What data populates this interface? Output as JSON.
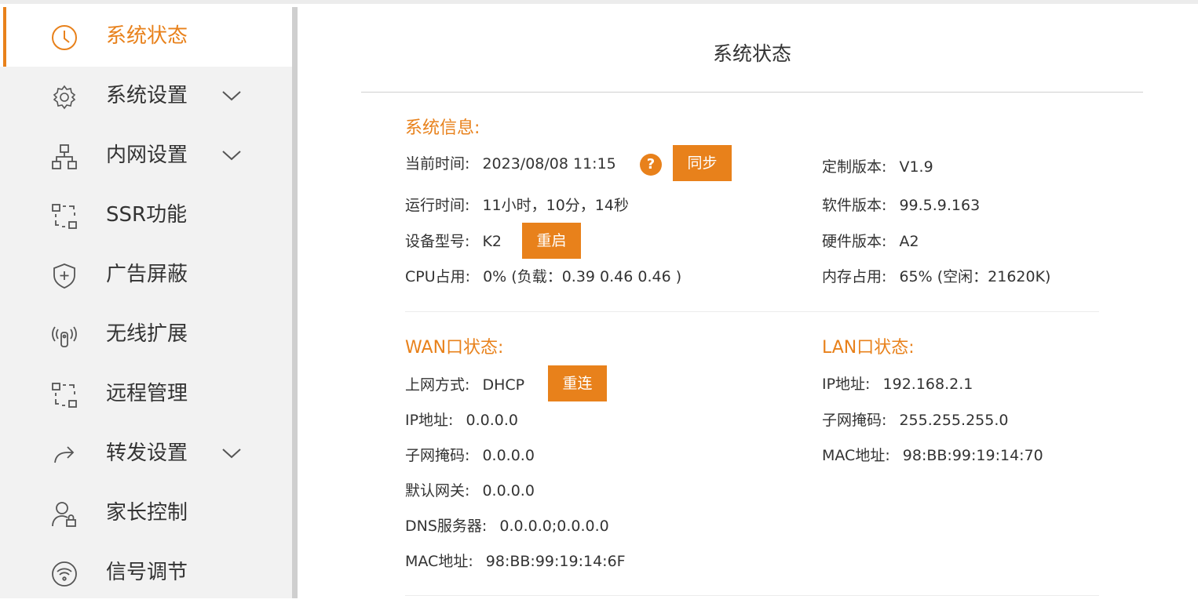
{
  "sidebar": {
    "items": [
      {
        "label": "系统状态",
        "icon": "clock-icon",
        "active": true
      },
      {
        "label": "系统设置",
        "icon": "gear-icon",
        "expandable": true
      },
      {
        "label": "内网设置",
        "icon": "network-icon",
        "expandable": true
      },
      {
        "label": "SSR功能",
        "icon": "dashed-box-icon"
      },
      {
        "label": "广告屏蔽",
        "icon": "shield-plus-icon"
      },
      {
        "label": "无线扩展",
        "icon": "wireless-signal-icon"
      },
      {
        "label": "远程管理",
        "icon": "dashed-box-icon"
      },
      {
        "label": "转发设置",
        "icon": "forward-arrow-icon",
        "expandable": true
      },
      {
        "label": "家长控制",
        "icon": "user-lock-icon"
      },
      {
        "label": "信号调节",
        "icon": "wifi-circle-icon"
      }
    ]
  },
  "main": {
    "title": "系统状态",
    "system_info": {
      "title": "系统信息:",
      "current_time_label": "当前时间:",
      "current_time_value": "2023/08/08 11:15",
      "help_label": "?",
      "sync_button": "同步",
      "uptime_label": "运行时间:",
      "uptime_value": "11小时，10分，14秒",
      "model_label": "设备型号:",
      "model_value": "K2",
      "reboot_button": "重启",
      "cpu_label": "CPU占用:",
      "cpu_value": "0% (负载：0.39 0.46 0.46 )",
      "custom_version_label": "定制版本:",
      "custom_version_value": "V1.9",
      "software_version_label": "软件版本:",
      "software_version_value": "99.5.9.163",
      "hardware_version_label": "硬件版本:",
      "hardware_version_value": "A2",
      "memory_label": "内存占用:",
      "memory_value": "65% (空闲：21620K)"
    },
    "wan": {
      "title": "WAN口状态:",
      "mode_label": "上网方式:",
      "mode_value": "DHCP",
      "reconnect_button": "重连",
      "ip_label": "IP地址:",
      "ip_value": "0.0.0.0",
      "mask_label": "子网掩码:",
      "mask_value": "0.0.0.0",
      "gateway_label": "默认网关:",
      "gateway_value": "0.0.0.0",
      "dns_label": "DNS服务器:",
      "dns_value": "0.0.0.0;0.0.0.0",
      "mac_label": "MAC地址:",
      "mac_value": "98:BB:99:19:14:6F"
    },
    "lan": {
      "title": "LAN口状态:",
      "ip_label": "IP地址:",
      "ip_value": "192.168.2.1",
      "mask_label": "子网掩码:",
      "mask_value": "255.255.255.0",
      "mac_label": "MAC地址:",
      "mac_value": "98:BB:99:19:14:70"
    }
  },
  "colors": {
    "accent": "#e8811b",
    "sidebar_bg": "#f2f2f2",
    "text": "#333333"
  }
}
